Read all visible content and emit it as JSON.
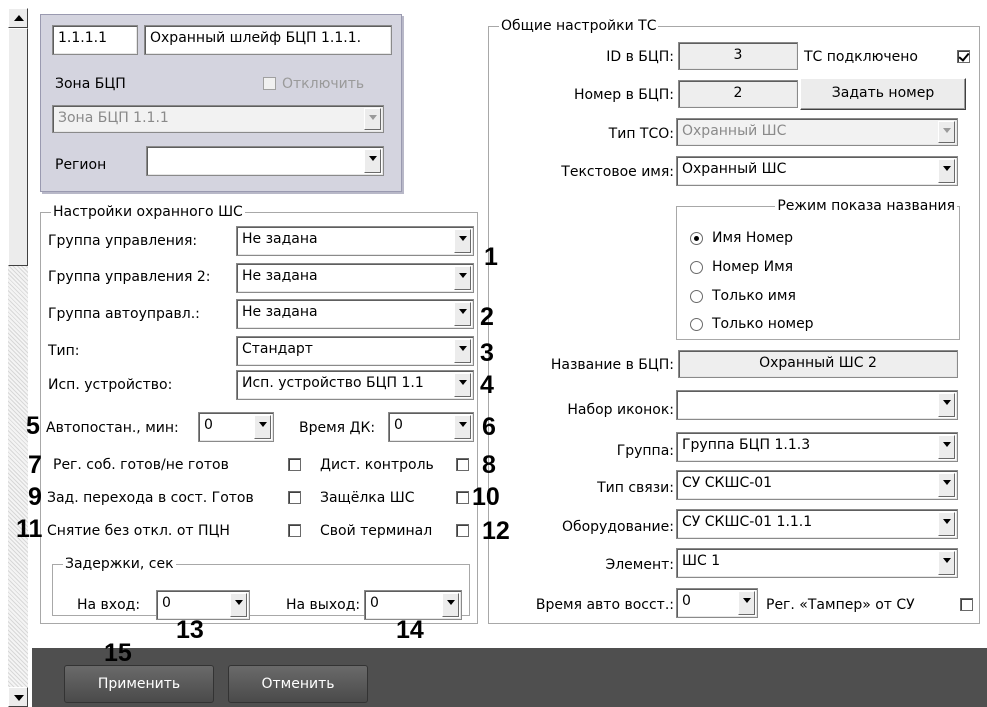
{
  "top_panel": {
    "address": "1.1.1.1",
    "name": "Охранный шлейф БЦП 1.1.1.",
    "zone_label": "Зона БЦП",
    "disable_label": "Отключить",
    "zone_value": "Зона БЦП 1.1.1",
    "region_label": "Регион",
    "region_value": ""
  },
  "security_group": {
    "caption": "Настройки охранного ШС",
    "control_group_label": "Группа управления:",
    "control_group_value": "Не задана",
    "control_group2_label": "Группа управления 2:",
    "control_group2_value": "Не задана",
    "auto_group_label": "Группа автоуправл.:",
    "auto_group_value": "Не задана",
    "type_label": "Тип:",
    "type_value": "Стандарт",
    "device_label": "Исп. устройство:",
    "device_value": "Исп. устройство БЦП 1.1",
    "autoarm_label": "Автопостан., мин:",
    "autoarm_value": "0",
    "dk_time_label": "Время ДК:",
    "dk_time_value": "0",
    "reg_ready_label": "Рег. соб. готов/не готов",
    "remote_control_label": "Дист. контроль",
    "ready_delay_label": "Зад. перехода в сост. Готов",
    "latch_label": "Защёлка ШС",
    "disarm_label": "Снятие без откл. от ПЦН",
    "own_terminal_label": "Свой терминал"
  },
  "delays_group": {
    "caption": "Задержки, сек",
    "entry_label": "На вход:",
    "entry_value": "0",
    "exit_label": "На выход:",
    "exit_value": "0"
  },
  "general_group": {
    "caption": "Общие настройки ТС",
    "id_label": "ID в БЦП:",
    "id_value": "3",
    "connected_label": "ТС подключено",
    "number_label": "Номер в БЦП:",
    "number_value": "2",
    "set_number_button": "Задать номер",
    "tso_type_label": "Тип ТСО:",
    "tso_type_value": "Охранный ШС",
    "text_name_label": "Текстовое имя:",
    "text_name_value": "Охранный ШС",
    "display_mode_caption": "Режим показа названия",
    "display_modes": [
      "Имя Номер",
      "Номер Имя",
      "Только имя",
      "Только номер"
    ],
    "name_bcp_label": "Название в БЦП:",
    "name_bcp_value": "Охранный ШС 2",
    "icon_set_label": "Набор иконок:",
    "icon_set_value": "",
    "group_label": "Группа:",
    "group_value": "Группа БЦП 1.1.3",
    "link_type_label": "Тип связи:",
    "link_type_value": "СУ СКШС-01",
    "equipment_label": "Оборудование:",
    "equipment_value": "СУ СКШС-01 1.1.1",
    "element_label": "Элемент:",
    "element_value": "ШС 1",
    "auto_restore_label": "Время авто восст.:",
    "auto_restore_value": "0",
    "tamper_label": "Рег. «Тампер» от СУ"
  },
  "callouts": [
    "1",
    "2",
    "3",
    "4",
    "5",
    "6",
    "7",
    "8",
    "9",
    "10",
    "11",
    "12",
    "13",
    "14",
    "15"
  ],
  "footer": {
    "apply_button": "Применить",
    "cancel_button": "Отменить"
  }
}
